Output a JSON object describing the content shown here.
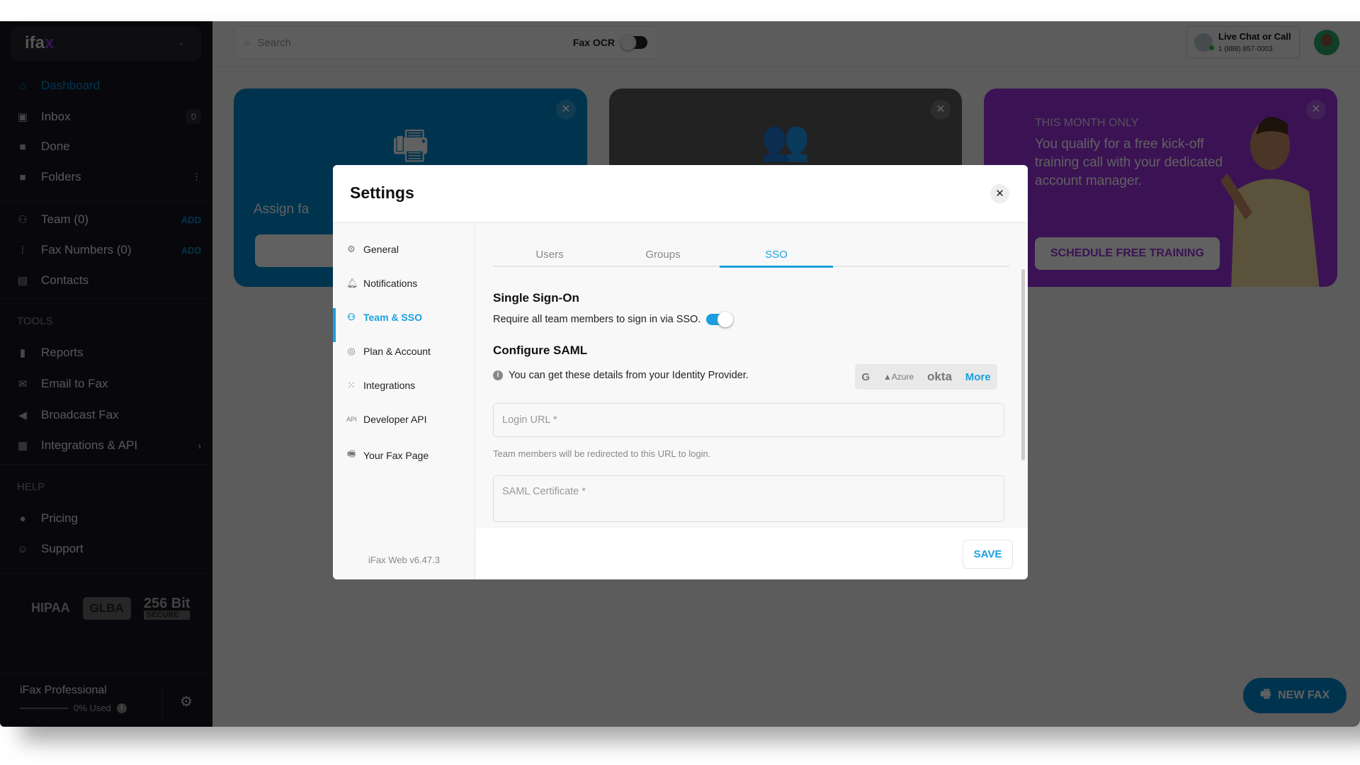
{
  "sidebar": {
    "logo": "ifax",
    "items": [
      {
        "label": "Dashboard",
        "icon": "home-icon"
      },
      {
        "label": "Inbox",
        "icon": "inbox-icon",
        "count": "0"
      },
      {
        "label": "Done",
        "icon": "done-folder-icon"
      },
      {
        "label": "Folders",
        "icon": "folder-icon"
      },
      {
        "label": "Team (0)",
        "icon": "team-icon",
        "action": "ADD"
      },
      {
        "label": "Fax Numbers (0)",
        "icon": "dialpad-icon",
        "action": "ADD"
      },
      {
        "label": "Contacts",
        "icon": "contacts-icon"
      }
    ],
    "tools_header": "TOOLS",
    "tools": [
      {
        "label": "Reports",
        "icon": "bar-chart-icon"
      },
      {
        "label": "Email to Fax",
        "icon": "mail-icon"
      },
      {
        "label": "Broadcast Fax",
        "icon": "megaphone-icon"
      },
      {
        "label": "Integrations & API",
        "icon": "puzzle-icon"
      }
    ],
    "help_header": "HELP",
    "help": [
      {
        "label": "Pricing",
        "icon": "pricing-icon"
      },
      {
        "label": "Support",
        "icon": "support-icon"
      }
    ],
    "badges": {
      "hipaa": "HIPAA",
      "glba": "GLBA",
      "bit": "256 Bit",
      "secure": "SECURE"
    },
    "plan": {
      "name": "iFax Professional",
      "usage": "0% Used",
      "usage_fraction": 0
    }
  },
  "topbar": {
    "search_placeholder": "Search",
    "fax_ocr": "Fax OCR",
    "fax_ocr_on": false,
    "chat_title": "Live Chat or Call",
    "chat_phone": "1 (888) 857-0003"
  },
  "cards": [
    {
      "text": "Assign fa",
      "color": "#0089cd"
    },
    {
      "color": "#5a5a5a"
    },
    {
      "eyebrow": "THIS MONTH ONLY",
      "body": "You qualify for a free kick-off training call with your dedicated account manager.",
      "button": "SCHEDULE FREE TRAINING",
      "color": "#9a33de"
    }
  ],
  "new_fax": "NEW FAX",
  "dialog": {
    "title": "Settings",
    "nav": [
      {
        "label": "General",
        "icon": "gear-icon"
      },
      {
        "label": "Notifications",
        "icon": "bell-icon"
      },
      {
        "label": "Team & SSO",
        "icon": "team-icon",
        "active": true
      },
      {
        "label": "Plan & Account",
        "icon": "account-icon"
      },
      {
        "label": "Integrations",
        "icon": "grid-icon"
      },
      {
        "label": "Developer API",
        "icon": "api-icon"
      },
      {
        "label": "Your Fax Page",
        "icon": "fax-icon"
      }
    ],
    "version": "iFax Web v6.47.3",
    "tabs": [
      {
        "label": "Users"
      },
      {
        "label": "Groups"
      },
      {
        "label": "SSO",
        "active": true
      }
    ],
    "sso_title": "Single Sign-On",
    "sso_require": "Require all team members to sign in via SSO.",
    "sso_enabled": true,
    "saml_title": "Configure SAML",
    "saml_info": "You can get these details from your Identity Provider.",
    "providers": {
      "google": "G",
      "azure": "Azure",
      "okta": "okta",
      "more": "More"
    },
    "login_url_placeholder": "Login URL *",
    "login_url_help": "Team members will be redirected to this URL to login.",
    "cert_placeholder": "SAML Certificate *",
    "save": "SAVE"
  },
  "colors": {
    "accent": "#1a9fe0",
    "brand_blue": "#0089cd",
    "promo_purple": "#9a33de"
  }
}
